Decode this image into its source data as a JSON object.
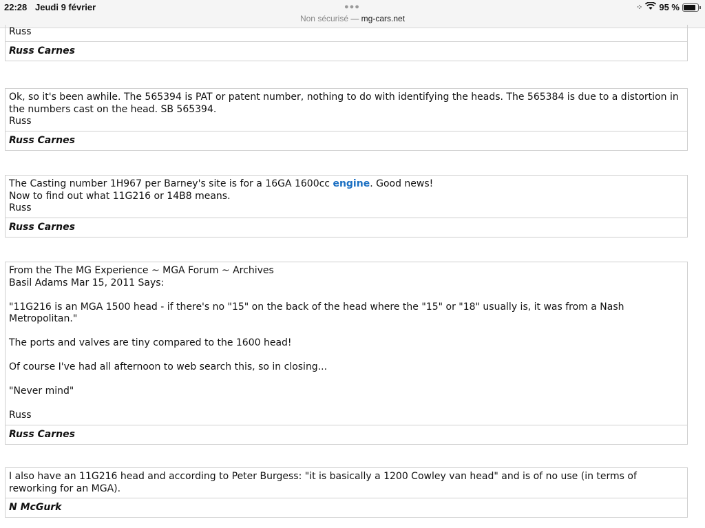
{
  "status_bar": {
    "time": "22:28",
    "date": "Jeudi 9 février",
    "battery": "95 %",
    "battery_level": 0.95,
    "url_prefix": "Non sécurisé — ",
    "url_domain": "mg-cars.net"
  },
  "posts": [
    {
      "body": "Russ",
      "author": "Russ Carnes"
    },
    {
      "body": "Ok, so it's been awhile. The 565394 is PAT or patent number, nothing to do with identifying the heads. The 565384 is due to a distortion in the numbers cast on the head. SB 565394.\nRuss",
      "author": "Russ Carnes"
    },
    {
      "body_before": "The Casting number 1H967 per Barney's site is for a 16GA 1600cc ",
      "body_link": "engine",
      "body_after": ". Good news!\nNow to find out what 11G216 or 14B8 means.\nRuss",
      "author": "Russ Carnes"
    },
    {
      "body": "From the The MG Experience ~ MGA Forum ~ Archives\nBasil Adams Mar 15, 2011 Says:\n\n\"11G216 is an MGA 1500 head - if there's no \"15\" on the back of the head where the \"15\" or \"18\" usually is, it was from a Nash Metropolitan.\"\n\nThe ports and valves are tiny compared to the 1600 head!\n\nOf course I've had all afternoon to web search this, so in closing...\n\n\"Never mind\"\n\nRuss",
      "author": "Russ Carnes"
    },
    {
      "body": "I also have an 11G216 head and according to Peter Burgess: \"it is basically a 1200 Cowley van head\" and is of no use (in terms of reworking for an MGA).",
      "author": "N McGurk"
    }
  ],
  "icons": {
    "wifi": "wifi-icon",
    "signal": "activity-icon",
    "battery": "battery-icon",
    "menu": "more-dots-icon"
  }
}
